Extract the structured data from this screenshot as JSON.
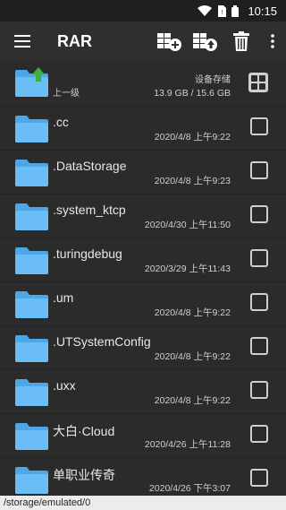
{
  "status": {
    "time": "10:15"
  },
  "appbar": {
    "title": "RAR",
    "icons": [
      "menu-icon",
      "add-archive-icon",
      "extract-archive-icon",
      "trash-icon",
      "more-vert-icon"
    ]
  },
  "parent": {
    "label": "上一级",
    "storage_label": "设备存储",
    "storage_size": "13.9 GB / 15.6 GB"
  },
  "files": [
    {
      "name": ".cc",
      "date": "2020/4/8 上午9:22"
    },
    {
      "name": ".DataStorage",
      "date": "2020/4/8 上午9:23"
    },
    {
      "name": ".system_ktcp",
      "date": "2020/4/30 上午11:50"
    },
    {
      "name": ".turingdebug",
      "date": "2020/3/29 上午11:43"
    },
    {
      "name": ".um",
      "date": "2020/4/8 上午9:22"
    },
    {
      "name": ".UTSystemConfig",
      "date": "2020/4/8 上午9:22"
    },
    {
      "name": ".uxx",
      "date": "2020/4/8 上午9:22"
    },
    {
      "name": "大白·Cloud",
      "date": "2020/4/26 上午11:28"
    },
    {
      "name": "单职业传奇",
      "date": "2020/4/26 下午3:07"
    }
  ],
  "path": "/storage/emulated/0",
  "colors": {
    "folder": "#4da6e8",
    "folder_tab": "#6bbdf5",
    "up_arrow": "#3cb043"
  }
}
